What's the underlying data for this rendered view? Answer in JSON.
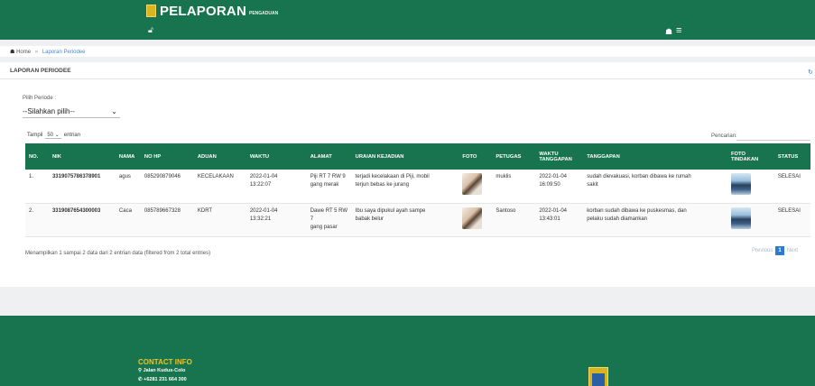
{
  "header": {
    "brand_title": "PELAPORAN",
    "brand_sub": "PENGADUAN",
    "lock_icon": "unlock-icon",
    "home_icon": "home-icon",
    "menu_icon": "hamburger-icon"
  },
  "breadcrumb": {
    "home": "Home",
    "separator": "»",
    "current": "Laporan Periodee"
  },
  "panel": {
    "title": "LAPORAN PERIODEE",
    "refresh_icon": "refresh-icon"
  },
  "filter": {
    "periode_label": "Pilih Periode :",
    "periode_value": "--Silahkan pilih--",
    "tampil_label": "Tampil",
    "entries_value": "50",
    "entries_suffix": "entrian",
    "search_label": "Pencarian:"
  },
  "table": {
    "headers": {
      "no": "NO.",
      "nik": "NIK",
      "nama": "NAMA",
      "nohp": "NO HP",
      "aduan": "ADUAN",
      "waktu": "WAKTU",
      "alamat": "ALAMAT",
      "uraian": "URAIAN KEJADIAN",
      "foto": "FOTO",
      "petugas": "PETUGAS",
      "waktu_tanggapan_1": "WAKTU",
      "waktu_tanggapan_2": "TANGGAPAN",
      "tanggapan": "TANGGAPAN",
      "foto_tindakan_1": "FOTO",
      "foto_tindakan_2": "TINDAKAN",
      "status": "STATUS"
    },
    "rows": [
      {
        "no": "1.",
        "nik": "3319075786378901",
        "nama": "agus",
        "nohp": "085290879046",
        "aduan": "KECELAKAAN",
        "waktu_date": "2022-01-04",
        "waktu_time": "13:22:07",
        "alamat_1": "Piji RT 7 RW 9",
        "alamat_2": "gang merak",
        "uraian_1": "terjadi kecelakaan di Piji, mobil",
        "uraian_2": "terjun bebas ke jurang",
        "petugas": "muklis",
        "wt_date": "2022-01-04",
        "wt_time": "16:09:50",
        "tanggapan_1": "sudah dievakuasi, korban dibawa ke rumah",
        "tanggapan_2": "sakit",
        "status": "SELESAI"
      },
      {
        "no": "2.",
        "nik": "3319087654300003",
        "nama": "Caca",
        "nohp": "085789667328",
        "aduan": "KDRT",
        "waktu_date": "2022-01-04",
        "waktu_time": "13:32:21",
        "alamat_1": "Dawe RT 5 RW 7",
        "alamat_2": "gang pasar",
        "uraian_1": "Ibu saya dipukul ayah sampe",
        "uraian_2": "babak belur",
        "petugas": "Santoso",
        "wt_date": "2022-01-04",
        "wt_time": "13:43:01",
        "tanggapan_1": "korban sudah dibawa ke puskesmas, dan",
        "tanggapan_2": "pelaku sudah diamankan",
        "status": "SELESAI"
      }
    ]
  },
  "pagination": {
    "info": "Menampilkan 1 sampai 2 data dari 2 entrian data (filtered from 2 total entries)",
    "previous": "Previous",
    "page": "1",
    "next": "Next"
  },
  "footer": {
    "contact_title": "CONTACT INFO",
    "address": "Jalan Kudus-Colo",
    "phone": "+6281 231 664 300",
    "location_icon": "map-pin-icon",
    "phone_icon": "phone-icon"
  },
  "colors": {
    "primary": "#17744f",
    "accent": "#2a7bd6",
    "gold": "#f2c21d"
  }
}
